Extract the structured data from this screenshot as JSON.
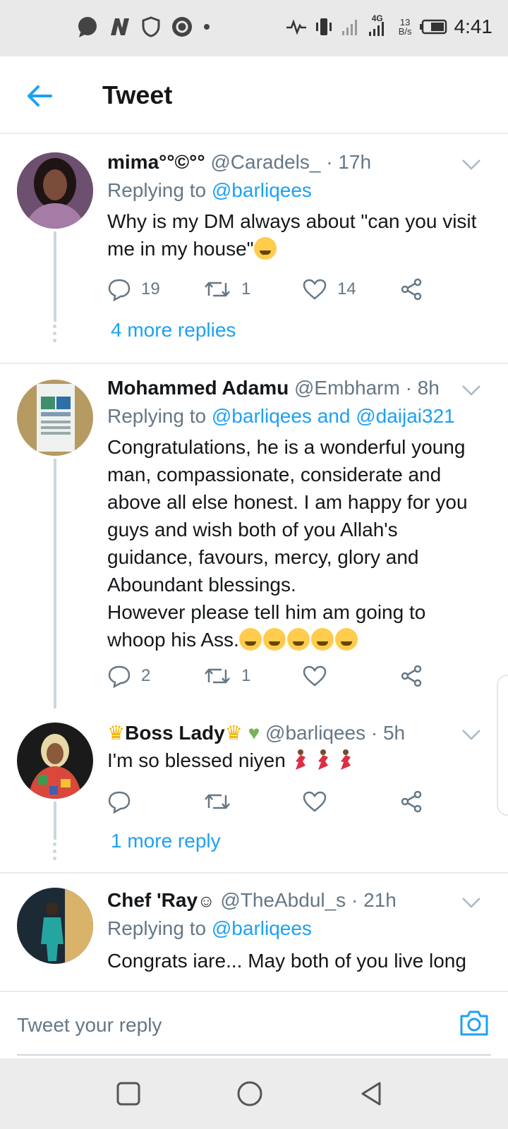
{
  "status_bar": {
    "time": "4:41",
    "network": "4G",
    "speed_value": "13",
    "speed_unit": "B/s",
    "icons_left": [
      "chat-bubble-icon",
      "n-app-icon",
      "shield-icon",
      "app-swirl-icon",
      "dot-icon"
    ],
    "icons_right": [
      "activity-icon",
      "vibrate-icon",
      "signal-icon",
      "signal-4g-icon",
      "battery-icon"
    ]
  },
  "app_bar": {
    "title": "Tweet",
    "back_icon": "arrow-left-icon"
  },
  "colors": {
    "accent": "#1da1f2",
    "secondary_text": "#657786",
    "divider": "#e6ecf0"
  },
  "tweets": [
    {
      "name": "mima°°©°°",
      "handle": "@Caradels_",
      "time": "· 17h",
      "replying_label": "Replying to",
      "replying_to": "@barliqees",
      "text": "Why is my DM always about \"can you visit me in my house\"",
      "reply_count": "19",
      "retweet_count": "1",
      "like_count": "14",
      "more_replies": "4 more replies"
    },
    {
      "name": "Mohammed Adamu",
      "handle": "@Embharm",
      "time": "· 8h",
      "replying_label": "Replying to",
      "replying_to": "@barliqees and @daijai321",
      "text_lines": [
        "Congratulations, he is a wonderful young",
        "man, compassionate,  considerate and",
        "above all else honest. I am happy for you",
        "guys and wish both of you  Allah's",
        "guidance,  favours,  mercy, glory and",
        "Aboundant blessings.",
        "However please tell him am going to",
        "whoop his Ass."
      ],
      "reply_count": "2",
      "retweet_count": "1",
      "like_count": ""
    },
    {
      "name": "Boss Lady",
      "handle": "@barliqees",
      "time": "· 5h",
      "text": "I'm so blessed niyen",
      "reply_count": "",
      "retweet_count": "",
      "like_count": "",
      "more_replies": "1 more reply"
    },
    {
      "name": "Chef 'Ray",
      "handle": "@TheAbdul_s",
      "time": "· 21h",
      "replying_label": "Replying to",
      "replying_to": "@barliqees",
      "text": "Congrats iare... May both of you live long"
    }
  ],
  "composer": {
    "placeholder": "Tweet your reply",
    "camera_icon": "camera-icon"
  },
  "nav_bar": {
    "icons": [
      "recents-square-icon",
      "home-circle-icon",
      "back-triangle-icon"
    ]
  }
}
